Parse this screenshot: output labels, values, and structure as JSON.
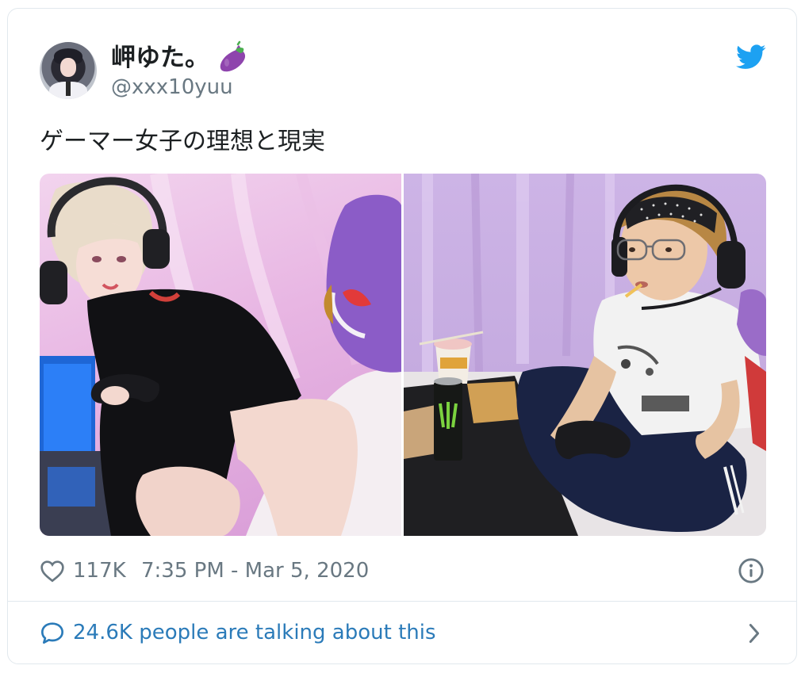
{
  "author": {
    "display_name": "岬ゆた。",
    "username": "@xxx10yuu",
    "avatar_icon": "user-avatar",
    "emoji_icon": "eggplant-icon"
  },
  "brand": {
    "icon": "twitter-bird-icon",
    "color": "#1da1f2"
  },
  "tweet": {
    "text": "ゲーマー女子の理想と現実",
    "photos": [
      "photo-ideal-gamer-girl",
      "photo-reality-gamer-girl"
    ]
  },
  "stats": {
    "like_icon": "heart-icon",
    "like_count": "117K",
    "timestamp": "7:35 PM - Mar 5, 2020",
    "info_icon": "info-icon"
  },
  "footer": {
    "icon": "speech-bubble-icon",
    "talking_text": "24.6K people are talking about this",
    "chevron_icon": "chevron-right-icon",
    "link_color": "#2b7bb9"
  },
  "colors": {
    "text": "#1c2022",
    "secondary": "#697882",
    "border": "#e1e8ed"
  }
}
